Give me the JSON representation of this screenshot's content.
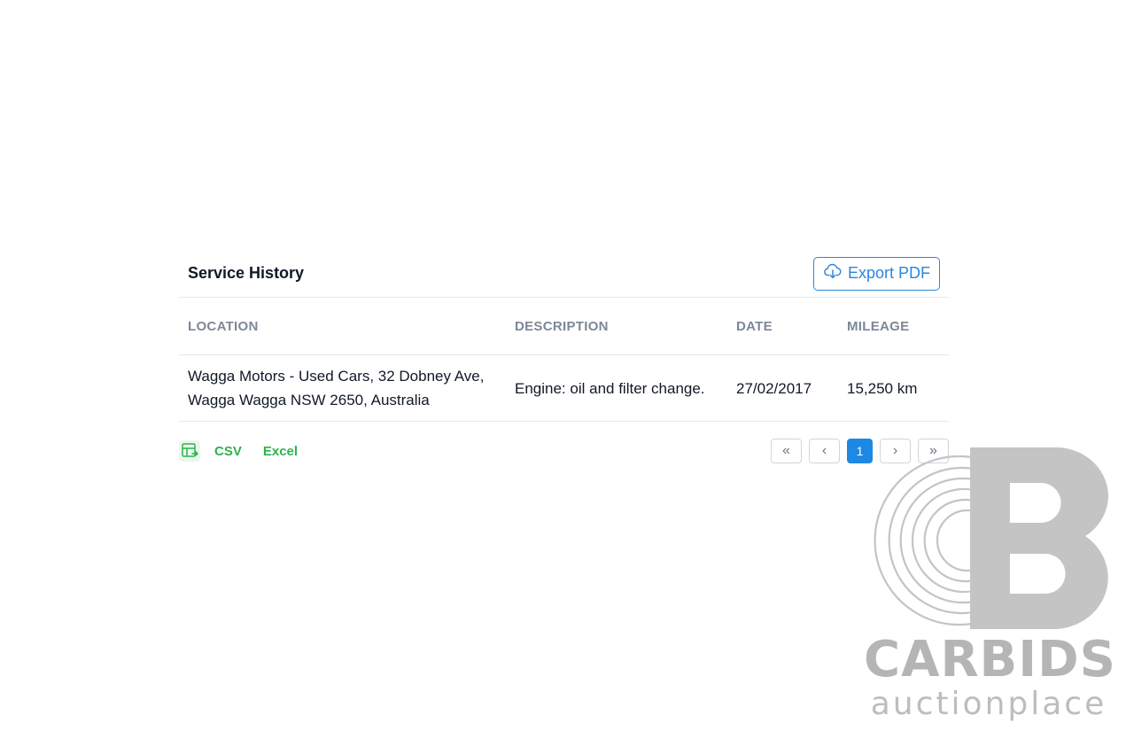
{
  "panel": {
    "title": "Service History",
    "export_pdf_label": "Export PDF"
  },
  "table": {
    "columns": [
      "LOCATION",
      "DESCRIPTION",
      "DATE",
      "MILEAGE"
    ],
    "rows": [
      {
        "location_line1": "Wagga Motors - Used Cars, 32 Dobney Ave,",
        "location_line2": "Wagga Wagga NSW 2650, Australia",
        "description": "Engine: oil and filter change.",
        "date": "27/02/2017",
        "mileage": "15,250 km"
      }
    ]
  },
  "footer": {
    "csv_label": "CSV",
    "excel_label": "Excel",
    "pagination": {
      "first": "«",
      "prev": "‹",
      "current": "1",
      "next": "›",
      "last": "»"
    }
  },
  "watermark": {
    "brand": "CARBIDS",
    "sub": "auctionplace"
  },
  "colors": {
    "accent_blue": "#2b87db",
    "export_green": "#2fb24c",
    "header_gray": "#7c8896",
    "watermark_gray": "#b5b5b5"
  }
}
